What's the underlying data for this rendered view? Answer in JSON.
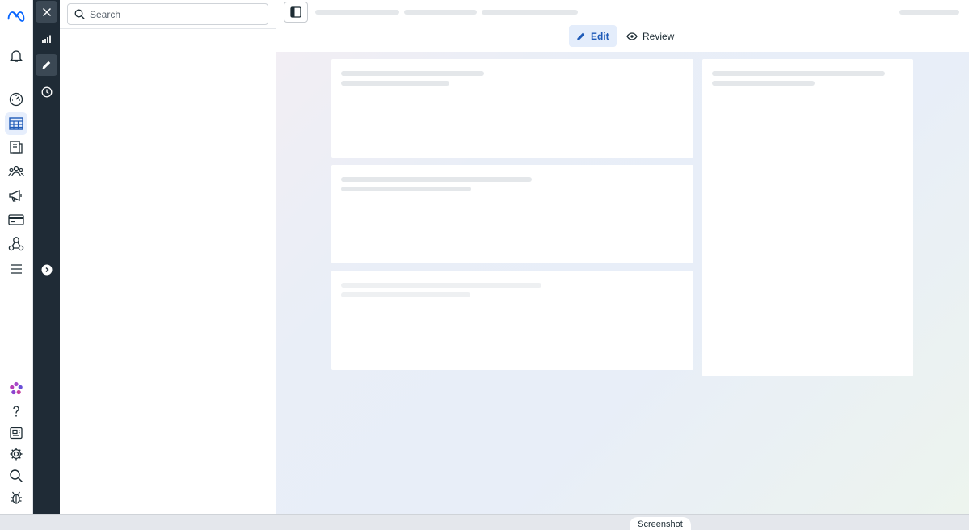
{
  "search": {
    "placeholder": "Search"
  },
  "modes": {
    "edit_label": "Edit",
    "review_label": "Review"
  },
  "footer": {
    "screenshot_label": "Screenshot"
  },
  "colors": {
    "brand": "#0866ff",
    "rail_dark": "#1f2b36",
    "accent": "#1f5bb8"
  },
  "rail_icons": [
    "meta-logo-icon",
    "bell-icon",
    "speedometer-icon",
    "table-grid-icon",
    "catalog-icon",
    "audience-icon",
    "megaphone-icon",
    "credit-card-icon",
    "network-icon",
    "menu-icon",
    "flower-icon",
    "help-icon",
    "news-icon",
    "settings-icon",
    "search-icon",
    "bug-icon"
  ],
  "strip_icons": [
    "close-icon",
    "bar-chart-icon",
    "pencil-icon",
    "clock-icon",
    "chevron-right-icon"
  ]
}
